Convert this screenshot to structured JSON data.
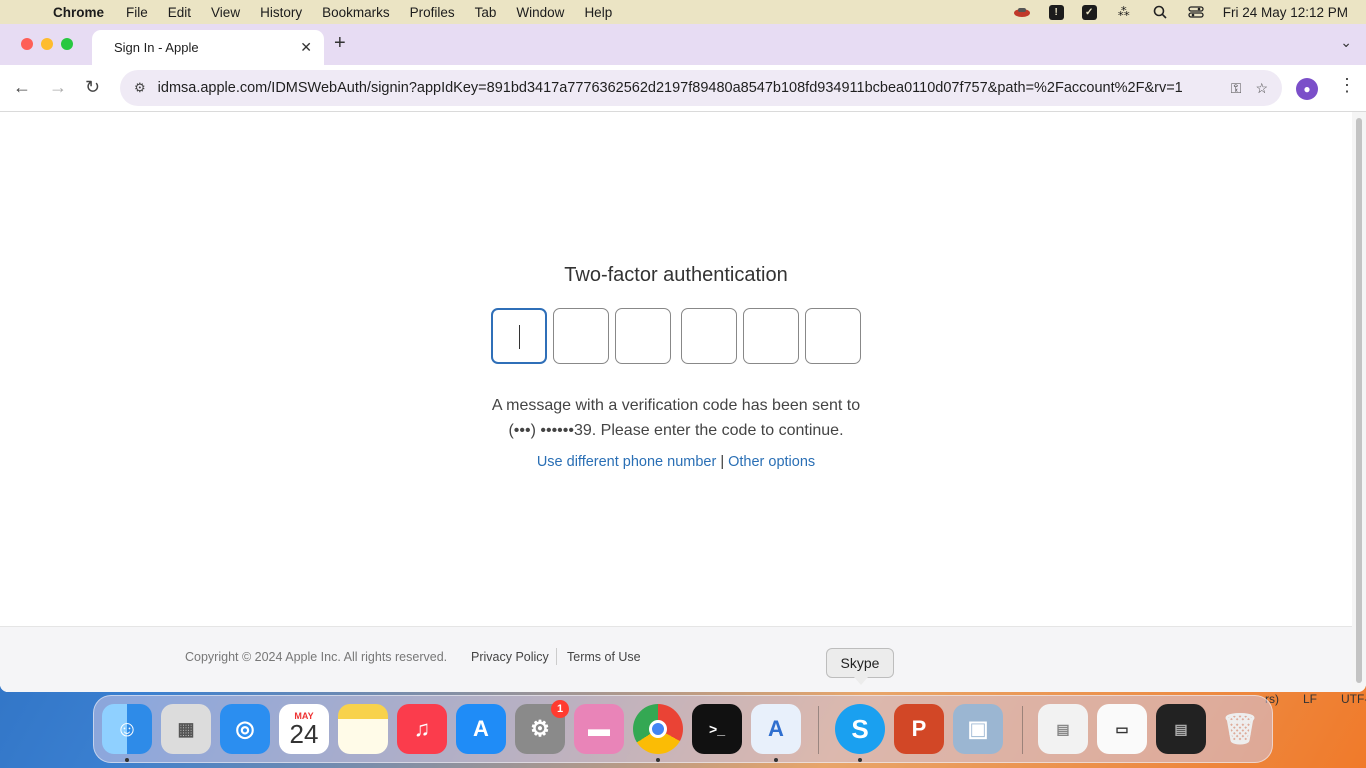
{
  "menubar": {
    "app": "Chrome",
    "menus": [
      "File",
      "Edit",
      "View",
      "History",
      "Bookmarks",
      "Profiles",
      "Tab",
      "Window",
      "Help"
    ],
    "datetime": "Fri 24 May  12:12 PM"
  },
  "tab": {
    "title": "Sign In - Apple"
  },
  "address": {
    "url": "idmsa.apple.com/IDMSWebAuth/signin?appIdKey=891bd3417a7776362562d2197f89480a8547b108fd934911bcbea0110d07f757&path=%2Faccount%2F&rv=1"
  },
  "auth": {
    "heading": "Two-factor authentication",
    "message_line1": "A message with a verification code has been sent to",
    "message_line2": "(•••) ••••••39. Please enter the code to continue.",
    "link_phone": "Use different phone number",
    "link_separator": "|",
    "link_other": "Other options"
  },
  "footer": {
    "copyright": "Copyright © 2024 Apple Inc. All rights reserved.",
    "privacy": "Privacy Policy",
    "terms": "Terms of Use"
  },
  "tooltip": "Skype",
  "statusbar": {
    "a": "rs)",
    "b": "LF",
    "c": "UTF-"
  },
  "dock": {
    "calendar_month": "MAY",
    "calendar_day": "24",
    "settings_badge": "1",
    "skype_glyph": "S",
    "powerpoint_glyph": "P"
  },
  "colors": {
    "accent": "#2f6fb8",
    "link": "#2a6fb5",
    "tabstrip": "#e7dcf3"
  }
}
